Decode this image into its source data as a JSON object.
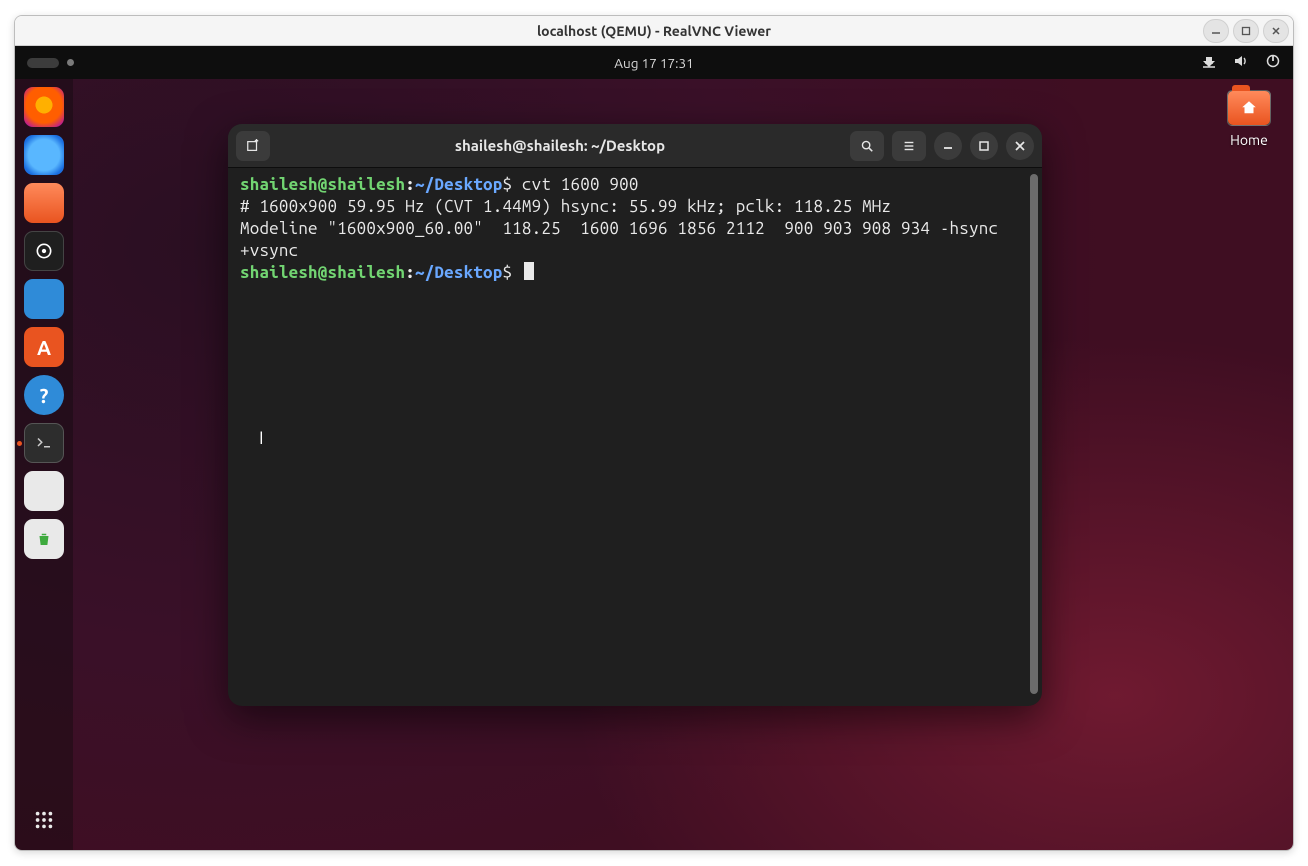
{
  "vnc": {
    "title": "localhost (QEMU) - RealVNC Viewer"
  },
  "topbar": {
    "datetime": "Aug 17  17:31"
  },
  "home_icon": {
    "label": "Home"
  },
  "dock": {
    "apps": [
      "firefox",
      "thunderbird",
      "files",
      "rhythmbox",
      "libreoffice-writer",
      "ubuntu-software",
      "help",
      "terminal",
      "text-editor",
      "trash"
    ]
  },
  "terminal": {
    "title": "shailesh@shailesh: ~/Desktop",
    "prompt_user": "shailesh@shailesh",
    "prompt_path": "~/Desktop",
    "command1": "cvt 1600 900",
    "output_line1": "# 1600x900 59.95 Hz (CVT 1.44M9) hsync: 55.99 kHz; pclk: 118.25 MHz",
    "output_line2": "Modeline \"1600x900_60.00\"  118.25  1600 1696 1856 2112  900 903 908 934 -hsync +vsync"
  }
}
